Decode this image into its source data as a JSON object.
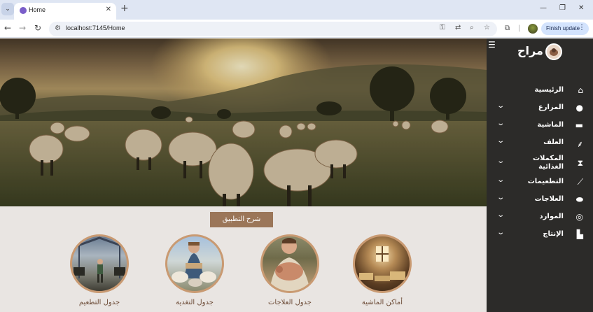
{
  "browser": {
    "tab_title": "Home",
    "url": "localhost:7145/Home",
    "update_label": "Finish update"
  },
  "sidebar": {
    "brand": "مراح",
    "items": [
      {
        "label": "الرئيسية",
        "icon": "home-icon",
        "expandable": false
      },
      {
        "label": "المزارع",
        "icon": "location-pin-icon",
        "expandable": true
      },
      {
        "label": "الماشية",
        "icon": "truck-icon",
        "expandable": true
      },
      {
        "label": "العلف",
        "icon": "wheat-icon",
        "expandable": true
      },
      {
        "label": "المكملات الغذائية",
        "icon": "hourglass-icon",
        "expandable": true
      },
      {
        "label": "التطعيمات",
        "icon": "syringe-icon",
        "expandable": true
      },
      {
        "label": "العلاجات",
        "icon": "pills-icon",
        "expandable": true
      },
      {
        "label": "الموارد",
        "icon": "coins-icon",
        "expandable": true
      },
      {
        "label": "الإنتاج",
        "icon": "industry-icon",
        "expandable": true
      }
    ]
  },
  "content": {
    "explain_button": "شرح التطبيق",
    "cards": [
      {
        "label": "أماكن الماشية"
      },
      {
        "label": "جدول العلاجات"
      },
      {
        "label": "جدول التغدية"
      },
      {
        "label": "جدول التطعيم"
      }
    ]
  }
}
